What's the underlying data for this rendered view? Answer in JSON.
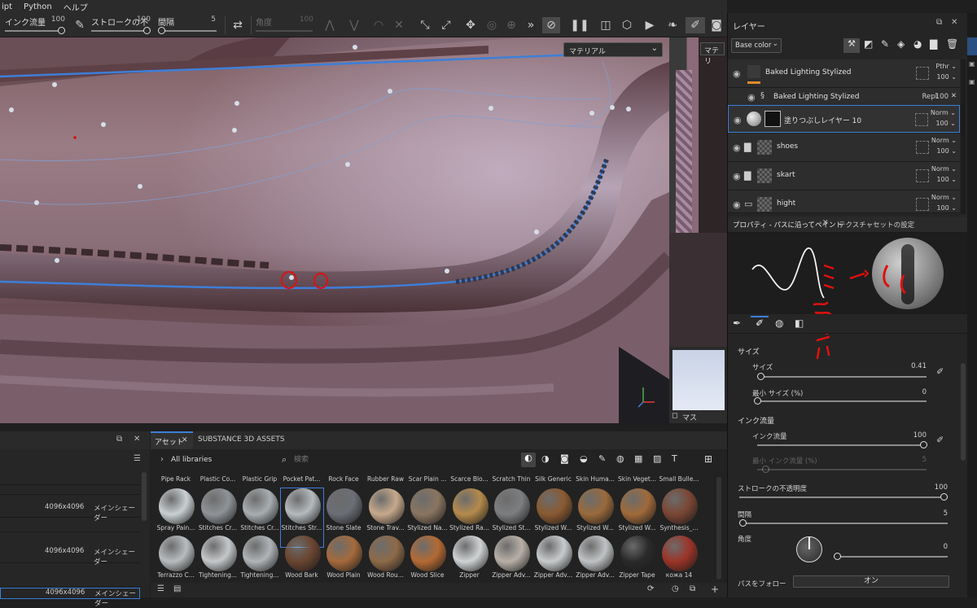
{
  "menu": [
    "ipt",
    "Python",
    "ヘルプ"
  ],
  "toolbar": {
    "ink_label": "インク流量",
    "ink_value": "100",
    "stroke_label": "ストロークの不",
    "stroke_value": "100",
    "spacing_label": "間隔",
    "spacing_value": "5",
    "angle_label": "角度",
    "angle_value": "100"
  },
  "viewport": {
    "material_dropdown": "マテリアル",
    "material_short": "マテリ",
    "mask_label": "マス"
  },
  "layers_panel": {
    "title": "レイヤー",
    "channel_select": "Base color",
    "layers": [
      {
        "name": "Baked Lighting Stylized",
        "blend": "Pthr",
        "opacity": "100"
      },
      {
        "name": "Baked Lighting Stylized",
        "blend": "Repl",
        "opacity": "100"
      },
      {
        "name": "塗りつぶしレイヤー 10",
        "blend": "Norm",
        "opacity": "100",
        "selected": true
      },
      {
        "name": "shoes",
        "blend": "Norm",
        "opacity": "100"
      },
      {
        "name": "skart",
        "blend": "Norm",
        "opacity": "100"
      },
      {
        "name": "hight",
        "blend": "Norm",
        "opacity": "100"
      }
    ]
  },
  "properties": {
    "tab_paint": "プロパティ - パスに沿ってペイント",
    "tab_texset": "テクスチャセットの設定",
    "section_size": "サイズ",
    "size_label": "サイズ",
    "size_value": "0.41",
    "size_level": 0.05,
    "min_size_label": "最小 サイズ (%)",
    "min_size_value": "0",
    "min_size_level": 0,
    "section_ink": "インク流量",
    "ink_label": "インク流量",
    "ink_value": "100",
    "ink_level": 1.0,
    "min_ink_label": "最小 インク流量 (%)",
    "min_ink_value": "5",
    "min_ink_level": 0.05,
    "stroke_opacity_label": "ストロークの不透明度",
    "stroke_opacity_value": "100",
    "stroke_opacity_level": 1.0,
    "spacing_label": "間隔",
    "spacing_value": "5",
    "angle_label": "角度",
    "angle_value": "0",
    "follow_path_label": "パスをフォロー",
    "follow_path_value": "オン"
  },
  "assets": {
    "tab_assets": "アセット",
    "tab_substance": "SUBSTANCE 3D ASSETS",
    "library": "All libraries",
    "search_placeholder": "検索",
    "row0": [
      "Pipe Rack",
      "Plastic Co...",
      "Plastic Grip",
      "Pocket Pat...",
      "Rock Face",
      "Rubber Raw",
      "Scar Plain ...",
      "Scarce Blo...",
      "Scratch Thin",
      "Silk Generic",
      "Skin Huma...",
      "Skin Veget...",
      "Small Bulle..."
    ],
    "row1": [
      "Spray Pain...",
      "Stitches Cr...",
      "Stitches Cr...",
      "Stitches Str...",
      "Stone Slate",
      "Stone Trav...",
      "Stylized Na...",
      "Stylized Ra...",
      "Stylized St...",
      "Stylized W...",
      "Stylized W...",
      "Stylized W...",
      "Synthesis_..."
    ],
    "row2": [
      "Terrazzo C...",
      "Tightening...",
      "Tightening...",
      "Wood Bark",
      "Wood Plain",
      "Wood Rou...",
      "Wood Slice",
      "Zipper",
      "Zipper Adv...",
      "Zipper Adv...",
      "Zipper Adv...",
      "Zipper Tape",
      "кожа 14"
    ],
    "colors": {
      "row1": [
        "#c9cfd2",
        "#8f9397",
        "#a8adb0",
        "#b5babd",
        "#6b6e75",
        "#c7a98c",
        "#8a7560",
        "#b58a4c",
        "#7d7e80",
        "#8a5a32",
        "#9a6a3c",
        "#a06a3a",
        "#7a4634"
      ],
      "row2": [
        "#b8bcbf",
        "#c5c8ca",
        "#b0b4b7",
        "#6a4530",
        "#a56a3c",
        "#8e6a48",
        "#b46a34",
        "#d0d3d5",
        "#b8b0a8",
        "#c8cbcd",
        "#c0c3c5",
        "#2a2a2a",
        "#9c3428"
      ]
    }
  },
  "bottom_left": {
    "rows": [
      {
        "res": "4096x4096",
        "shader": "メインシェーダー"
      },
      {
        "res": "4096x4096",
        "shader": "メインシェーダー"
      },
      {
        "res": "4096x4096",
        "shader": "メインシェーダー"
      }
    ]
  },
  "annotations": {
    "handwritten_note": "ミミとせいで"
  }
}
